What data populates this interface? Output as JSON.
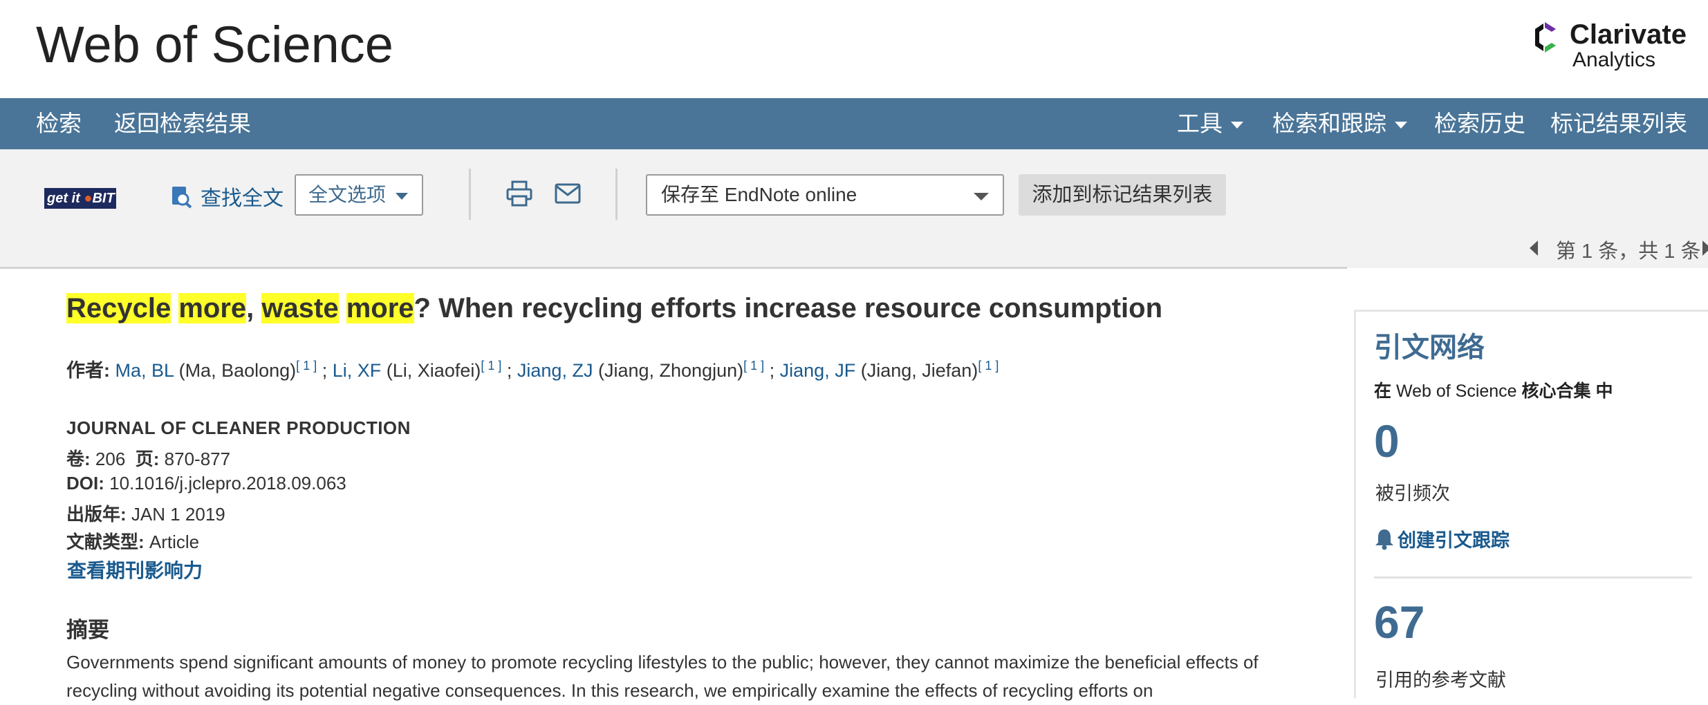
{
  "header": {
    "title": "Web of Science",
    "logo_text": "Clarivate",
    "logo_sub": "Analytics",
    "logo_colors": {
      "purple": "#6b2ea6",
      "green": "#36b34a",
      "black": "#111111"
    }
  },
  "nav": {
    "search": "检索",
    "back": "返回检索结果",
    "tools": "工具",
    "search_track": "检索和跟踪",
    "history": "检索历史",
    "marked_list": "标记结果列表",
    "bar_color": "#4a7598"
  },
  "toolbar": {
    "getit_prefix": "get it",
    "getit_suffix": "BIT",
    "find_fulltext": "查找全文",
    "fulltext_options": "全文选项",
    "save_to": "保存至 EndNote online",
    "add_to_marked": "添加到标记结果列表"
  },
  "pager": {
    "text": "第 1 条，共 1 条"
  },
  "article": {
    "title_parts": [
      "Recycle",
      " ",
      "more",
      ", ",
      "waste",
      " ",
      "more",
      "? When recycling efforts increase resource consumption"
    ],
    "authors_label": "作者:",
    "authors": [
      {
        "short": "Ma, BL",
        "full": "(Ma, Baolong)",
        "ref": "1"
      },
      {
        "short": "Li, XF",
        "full": "(Li, Xiaofei)",
        "ref": "1"
      },
      {
        "short": "Jiang, ZJ",
        "full": "(Jiang, Zhongjun)",
        "ref": "1"
      },
      {
        "short": "Jiang, JF",
        "full": "(Jiang, Jiefan)",
        "ref": "1"
      }
    ],
    "journal": "JOURNAL OF CLEANER PRODUCTION",
    "volume_label": "卷:",
    "volume": "206",
    "pages_label": "页:",
    "pages": "870-877",
    "doi_label": "DOI:",
    "doi": "10.1016/j.jclepro.2018.09.063",
    "pubdate_label": "出版年:",
    "pubdate": "JAN 1 2019",
    "doctype_label": "文献类型:",
    "doctype": "Article",
    "impact_link": "查看期刊影响力",
    "abstract_heading": "摘要",
    "abstract_text": "Governments spend significant amounts of money to promote recycling lifestyles to the public; however, they cannot maximize the beneficial effects of recycling without avoiding its potential negative consequences. In this research, we empirically examine the effects of recycling efforts on"
  },
  "citation_network": {
    "title": "引文网络",
    "subtitle_prefix": "在 ",
    "subtitle_db": "Web of Science",
    "subtitle_suffix": " 核心合集 中",
    "times_cited": "0",
    "times_cited_label": "被引频次",
    "create_alert": "创建引文跟踪",
    "cited_refs": "67",
    "cited_refs_label": "引用的参考文献"
  }
}
